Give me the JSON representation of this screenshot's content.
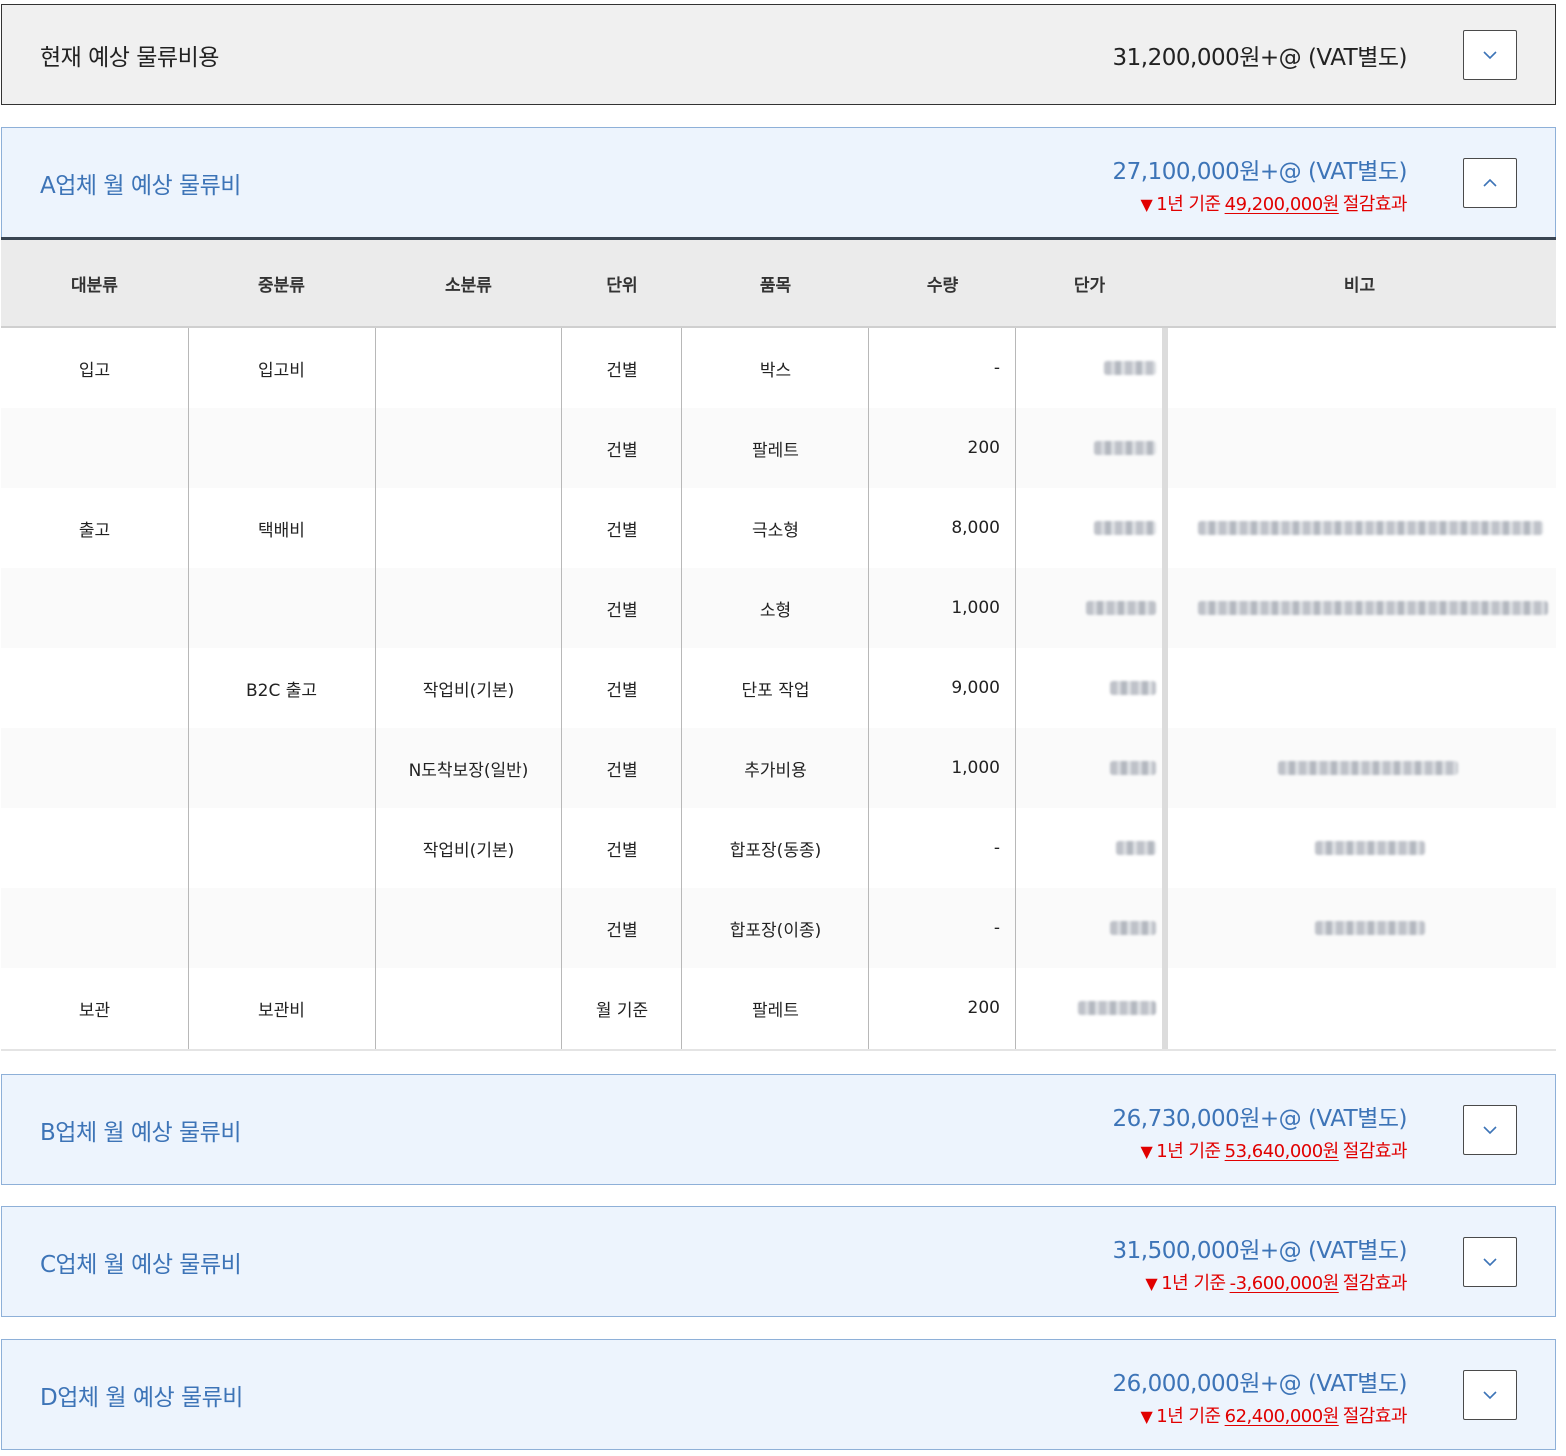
{
  "current": {
    "title": "현재 예상 물류비용",
    "amount": "31,200,000원+@ (VAT별도)"
  },
  "vendors": [
    {
      "title": "A업체 월 예상 물류비",
      "amount": "27,100,000원+@ (VAT별도)",
      "saving_prefix": "1년 기준",
      "saving_value": "49,200,000원",
      "saving_suffix": "절감효과",
      "expanded": true
    },
    {
      "title": "B업체 월 예상 물류비",
      "amount": "26,730,000원+@ (VAT별도)",
      "saving_prefix": "1년 기준",
      "saving_value": "53,640,000원",
      "saving_suffix": "절감효과",
      "expanded": false
    },
    {
      "title": "C업체 월 예상 물류비",
      "amount": "31,500,000원+@ (VAT별도)",
      "saving_prefix": "1년 기준",
      "saving_value": "-3,600,000원",
      "saving_suffix": "절감효과",
      "expanded": false
    },
    {
      "title": "D업체 월 예상 물류비",
      "amount": "26,000,000원+@ (VAT별도)",
      "saving_prefix": "1년 기준",
      "saving_value": "62,400,000원",
      "saving_suffix": "절감효과",
      "expanded": false
    }
  ],
  "table": {
    "headers": [
      "대분류",
      "중분류",
      "소분류",
      "단위",
      "품목",
      "수량",
      "단가",
      "비고"
    ],
    "rows": [
      {
        "major": "입고",
        "middle": "입고비",
        "minor": "",
        "unit": "건별",
        "item": "박스",
        "qty": "-"
      },
      {
        "major": "",
        "middle": "",
        "minor": "",
        "unit": "건별",
        "item": "팔레트",
        "qty": "200"
      },
      {
        "major": "출고",
        "middle": "택배비",
        "minor": "",
        "unit": "건별",
        "item": "극소형",
        "qty": "8,000"
      },
      {
        "major": "",
        "middle": "",
        "minor": "",
        "unit": "건별",
        "item": "소형",
        "qty": "1,000"
      },
      {
        "major": "",
        "middle": "B2C 출고",
        "minor": "작업비(기본)",
        "unit": "건별",
        "item": "단포 작업",
        "qty": "9,000"
      },
      {
        "major": "",
        "middle": "",
        "minor": "N도착보장(일반)",
        "unit": "건별",
        "item": "추가비용",
        "qty": "1,000"
      },
      {
        "major": "",
        "middle": "",
        "minor": "작업비(기본)",
        "unit": "건별",
        "item": "합포장(동종)",
        "qty": "-"
      },
      {
        "major": "",
        "middle": "",
        "minor": "",
        "unit": "건별",
        "item": "합포장(이종)",
        "qty": "-"
      },
      {
        "major": "보관",
        "middle": "보관비",
        "minor": "",
        "unit": "월 기준",
        "item": "팔레트",
        "qty": "200"
      }
    ]
  },
  "icons": {
    "collapsed": "chevron-down-icon",
    "expanded": "chevron-up-icon",
    "saving": "triangle-down-icon"
  },
  "colors": {
    "vendor_text": "#3d74b7",
    "saving_red": "#e10000",
    "vendor_bg": "#edf4fd"
  }
}
